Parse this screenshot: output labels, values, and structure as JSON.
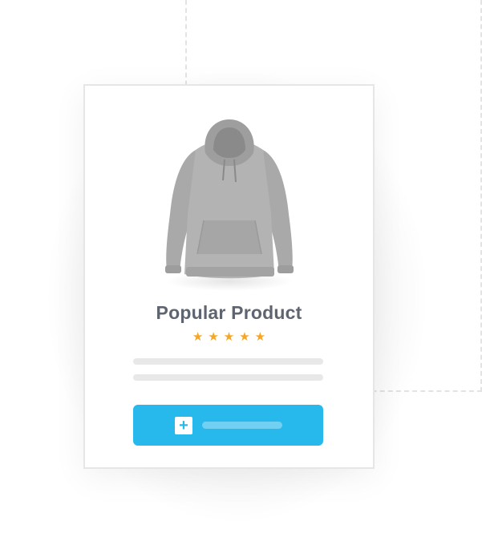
{
  "product": {
    "title": "Popular Product",
    "image_name": "gray-hoodie",
    "rating": 5,
    "rating_max": 5,
    "stars": "★★★★★"
  },
  "button": {
    "icon": "plus-icon",
    "icon_glyph": "+"
  },
  "colors": {
    "accent": "#27b9ec",
    "star": "#f5a623",
    "title": "#5f6570",
    "placeholder_line": "#e8e8e8",
    "dashed_border": "#e3e3e3"
  }
}
